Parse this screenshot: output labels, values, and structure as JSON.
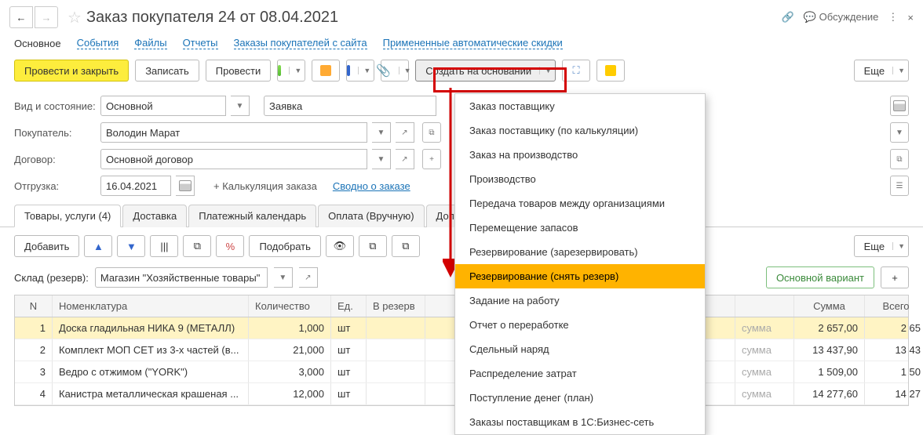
{
  "header": {
    "title": "Заказ покупателя 24 от 08.04.2021",
    "discuss": "Обсуждение"
  },
  "tabs": {
    "main": "Основное",
    "events": "События",
    "files": "Файлы",
    "reports": "Отчеты",
    "orders_site": "Заказы покупателей с сайта",
    "auto_disc": "Примененные автоматические скидки"
  },
  "toolbar": {
    "post_close": "Провести и закрыть",
    "save": "Записать",
    "post": "Провести",
    "create_based": "Создать на основании",
    "more": "Еще"
  },
  "form": {
    "kind_label": "Вид и состояние:",
    "kind_value": "Основной",
    "state_value": "Заявка",
    "buyer_label": "Покупатель:",
    "buyer_value": "Володин Марат",
    "contract_label": "Договор:",
    "contract_value": "Основной договор",
    "ship_label": "Отгрузка:",
    "ship_value": "16.04.2021",
    "calc_label": "+ Калькуляция заказа",
    "summary_link": "Сводно о заказе"
  },
  "subtabs": {
    "goods": "Товары, услуги (4)",
    "delivery": "Доставка",
    "pay_cal": "Платежный календарь",
    "payment": "Оплата (Вручную)",
    "extra": "Допол"
  },
  "subbar": {
    "add": "Добавить",
    "pick": "Подобрать",
    "more": "Еще"
  },
  "warehouse": {
    "label": "Склад (резерв):",
    "value": "Магазин \"Хозяйственные товары\"",
    "variant": "Основной вариант"
  },
  "thead": {
    "n": "N",
    "nomen": "Номенклатура",
    "qty": "Количество",
    "unit": "Ед.",
    "reserve": "В резерв",
    "sum_label": "сумма",
    "sum": "Сумма",
    "total": "Всего"
  },
  "rows": [
    {
      "n": "1",
      "name": "Доска гладильная  НИКА 9 (МЕТАЛЛ)",
      "qty": "1,000",
      "unit": "шт",
      "sum": "2 657,00",
      "total": "2 65"
    },
    {
      "n": "2",
      "name": "Комплект МОП СЕТ из 3-х частей (в...",
      "qty": "21,000",
      "unit": "шт",
      "sum": "13 437,90",
      "total": "13 43"
    },
    {
      "n": "3",
      "name": "Ведро с отжимом (\"YORK\")",
      "qty": "3,000",
      "unit": "шт",
      "sum": "1 509,00",
      "total": "1 50"
    },
    {
      "n": "4",
      "name": "Канистра металлическая крашеная ...",
      "qty": "12,000",
      "unit": "шт",
      "sum": "14 277,60",
      "total": "14 27"
    }
  ],
  "dropdown": [
    "Заказ поставщику",
    "Заказ поставщику (по калькуляции)",
    "Заказ на производство",
    "Производство",
    "Передача товаров между организациями",
    "Перемещение запасов",
    "Резервирование (зарезервировать)",
    "Резервирование (снять резерв)",
    "Задание на работу",
    "Отчет о переработке",
    "Сдельный наряд",
    "Распределение затрат",
    "Поступление денег (план)",
    "Заказы поставщикам в 1С:Бизнес-сеть"
  ],
  "dropdown_highlight": 7
}
